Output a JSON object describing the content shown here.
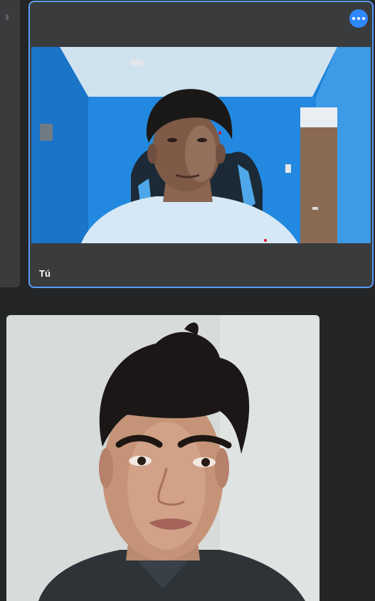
{
  "call": {
    "self_label": "Tú",
    "accent_color": "#5b9cf5",
    "more_button_color": "#2e89ff",
    "more_icon": "three-dots-icon"
  },
  "remote": {
    "background_color": "#d9dddc"
  }
}
